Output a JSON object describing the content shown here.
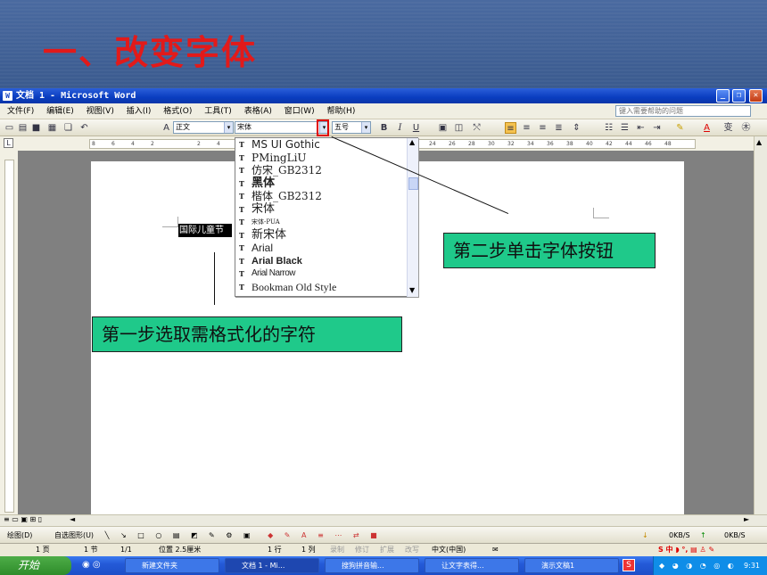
{
  "slide": {
    "title": "一、改变字体"
  },
  "window": {
    "title": "文档 1 - Microsoft Word",
    "app_icon": "W"
  },
  "menu": [
    "文件(F)",
    "编辑(E)",
    "视图(V)",
    "插入(I)",
    "格式(O)",
    "工具(T)",
    "表格(A)",
    "窗口(W)",
    "帮助(H)"
  ],
  "help_placeholder": "键入需要帮助的问题",
  "toolbar": {
    "style": "正文",
    "font": "宋体",
    "size": "五号",
    "bold": "B",
    "italic": "I",
    "underline": "U"
  },
  "ruler_ticks": [
    "8",
    "6",
    "4",
    "2",
    "2",
    "4",
    "24",
    "26",
    "28",
    "30",
    "32",
    "34",
    "36",
    "38",
    "40",
    "42",
    "44",
    "46",
    "48"
  ],
  "font_list": [
    {
      "name": "MS UI Gothic"
    },
    {
      "name": "PMingLiU"
    },
    {
      "name": "仿宋_GB2312"
    },
    {
      "name": "黑体"
    },
    {
      "name": "楷体_GB2312"
    },
    {
      "name": "宋体"
    },
    {
      "name": "宋体-PUA"
    },
    {
      "name": "新宋体"
    },
    {
      "name": "Arial"
    },
    {
      "name": "Arial Black"
    },
    {
      "name": "Arial Narrow"
    },
    {
      "name": "Bookman Old Style"
    }
  ],
  "document": {
    "selected_text": "国际儿童节"
  },
  "callouts": {
    "step1": "第一步选取需格式化的字符",
    "step2": "第二步单击字体按钮"
  },
  "drawing_toolbar": {
    "draw": "绘图(D)",
    "autoshapes": "自选图形(U)",
    "net_down": "0KB/S",
    "net_up": "0KB/S"
  },
  "status": {
    "page": "1 页",
    "section": "1 节",
    "pages": "1/1",
    "position": "位置 2.5厘米",
    "line": "1 行",
    "col": "1 列",
    "rec": "录制",
    "trk": "修订",
    "ext": "扩展",
    "ovr": "改写",
    "lang": "中文(中国)"
  },
  "taskbar": {
    "start": "开始",
    "items": [
      "新建文件夹",
      "文档 1 - Mi...",
      "搜狗拼音输...",
      "让文字表得...",
      "演示文稿1"
    ],
    "clock": "9:31"
  }
}
